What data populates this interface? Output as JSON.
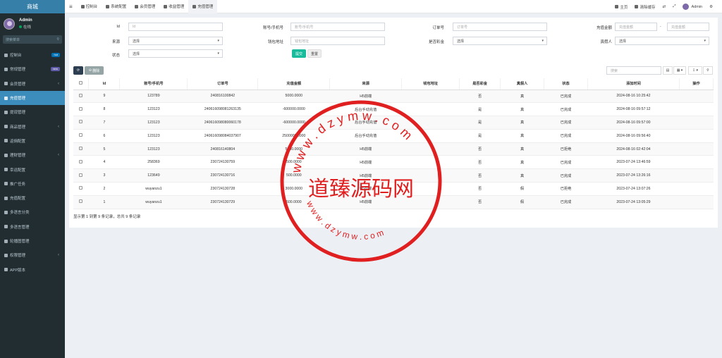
{
  "app": {
    "title": "商城"
  },
  "user": {
    "name": "Admin",
    "status": "在线"
  },
  "sidebar": {
    "search_placeholder": "搜索菜单",
    "items": [
      {
        "label": "控制台",
        "badge": "hot",
        "badge_color": "#0073b7"
      },
      {
        "label": "常规管理",
        "badge": "new",
        "badge_color": "#605ca8"
      },
      {
        "label": "会员管理",
        "chevron": "‹"
      },
      {
        "label": "充值管理"
      },
      {
        "label": "提现管理"
      },
      {
        "label": "商品管理",
        "chevron": "‹"
      },
      {
        "label": "返佣配置"
      },
      {
        "label": "理财管理",
        "chevron": "‹"
      },
      {
        "label": "幸运配置"
      },
      {
        "label": "推广任务"
      },
      {
        "label": "充值配置"
      },
      {
        "label": "多语言分类"
      },
      {
        "label": "多语言管理"
      },
      {
        "label": "轮播图管理"
      },
      {
        "label": "权限管理",
        "chevron": "‹"
      },
      {
        "label": "APP版本"
      }
    ]
  },
  "topbar": {
    "menu_icon": "≡",
    "tabs": [
      "控制台",
      "系统配置",
      "会员管理",
      "收益管理",
      "充值管理"
    ],
    "right": {
      "home": "主页",
      "clear": "清除缓存",
      "user": "Admin"
    }
  },
  "filters": {
    "id": {
      "label": "Id",
      "placeholder": "Id"
    },
    "account": {
      "label": "账号/手机号",
      "placeholder": "账号/手机号"
    },
    "order": {
      "label": "订单号",
      "placeholder": "订单号"
    },
    "amount": {
      "label": "充值金额",
      "placeholder_min": "充值金额",
      "sep": "-",
      "placeholder_max": "充值金额"
    },
    "source": {
      "label": "来源",
      "value": "选择"
    },
    "wallet": {
      "label": "钱包地址",
      "placeholder": "钱包地址"
    },
    "bonus": {
      "label": "是否彩金",
      "value": "选择"
    },
    "real": {
      "label": "真假人",
      "value": "选择"
    },
    "status": {
      "label": "状态",
      "value": "选择"
    },
    "submit": "提交",
    "reset": "重置"
  },
  "toolbar": {
    "refresh_icon": "⟳",
    "delete_label": "删除",
    "search_placeholder": "搜索",
    "toggle_icon": "▤",
    "columns_icon": "▦ ▾",
    "export_icon": "⇩ ▾",
    "search_icon": "⚲"
  },
  "table": {
    "columns": [
      "",
      "Id",
      "账号/手机号",
      "订单号",
      "充值金额",
      "来源",
      "钱包地址",
      "是否彩金",
      "真假人",
      "状态",
      "添加时间",
      "操作"
    ],
    "rows": [
      [
        "9",
        "123789",
        "240816100842",
        "5000.0000",
        "H5前端",
        "",
        "否",
        "真",
        "已完成",
        "2024-08-16 10:25:42",
        ""
      ],
      [
        "8",
        "123123",
        "240616098081263135",
        "-600000.0000",
        "后台手动充值",
        "",
        "是",
        "真",
        "已完成",
        "2024-08-16 09:57:12",
        ""
      ],
      [
        "7",
        "123123",
        "240616098080060178",
        "-600000.0000",
        "后台手动充值",
        "",
        "是",
        "真",
        "已完成",
        "2024-08-16 09:57:00",
        ""
      ],
      [
        "6",
        "123123",
        "240616098084037907",
        "2500000.0000",
        "后台手动充值",
        "",
        "是",
        "真",
        "已完成",
        "2024-08-16 09:56:40",
        ""
      ],
      [
        "5",
        "123123",
        "240816140804",
        "5000.0000",
        "H5前端",
        "",
        "否",
        "真",
        "已拒绝",
        "2024-08-16 02:42:04",
        ""
      ],
      [
        "4",
        "258369",
        "230724130759",
        "500.0000",
        "H5前端",
        "",
        "否",
        "真",
        "已完成",
        "2023-07-24 13:46:59",
        ""
      ],
      [
        "3",
        "123649",
        "230724130716",
        "500.0000",
        "H5前端",
        "",
        "否",
        "真",
        "已完成",
        "2023-07-24 13:26:16",
        ""
      ],
      [
        "2",
        "wuyanzu1",
        "230724130728",
        "3000.0000",
        "H5前端",
        "",
        "否",
        "假",
        "已拒绝",
        "2023-07-24 13:07:26",
        ""
      ],
      [
        "1",
        "wuyanzu1",
        "230724130729",
        "500.0000",
        "H5前端",
        "",
        "否",
        "假",
        "已完成",
        "2023-07-24 13:05:29",
        ""
      ]
    ]
  },
  "pagination": {
    "text": "显示第 1 到第 9 条记录，总共 9 条记录"
  },
  "watermark": {
    "top_text": "w w w . d z y m w . c o m",
    "center_text": "道臻源码网",
    "bottom_text": "w w w . d z y m w . c o m",
    "color": "#e02020"
  }
}
